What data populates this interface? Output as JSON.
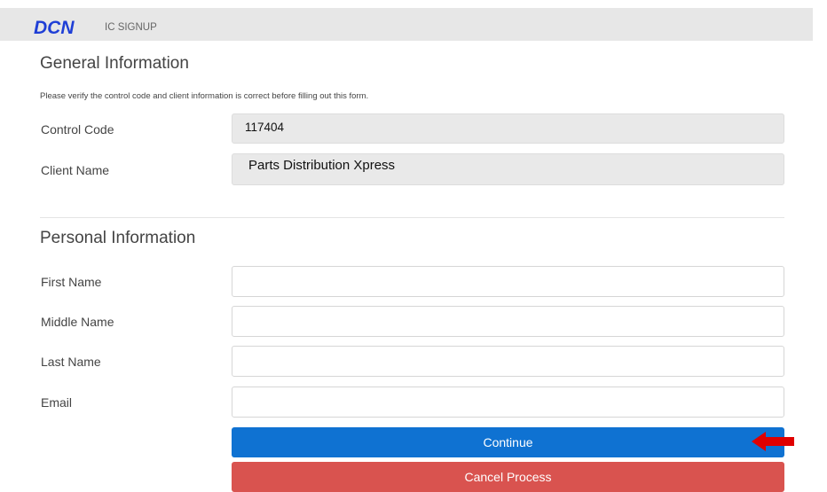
{
  "header": {
    "logo": "DCN",
    "app_title": "IC SIGNUP"
  },
  "general": {
    "title": "General Information",
    "intro": "Please verify the control code and client information is correct before filling out this form.",
    "control_code_label": "Control Code",
    "control_code_value": "117404",
    "client_name_label": "Client Name",
    "client_name_value": "Parts Distribution Xpress"
  },
  "personal": {
    "title": "Personal Information",
    "first_name_label": "First Name",
    "first_name_value": "",
    "middle_name_label": "Middle Name",
    "middle_name_value": "",
    "last_name_label": "Last Name",
    "last_name_value": "",
    "email_label": "Email",
    "email_value": ""
  },
  "actions": {
    "continue_label": "Continue",
    "cancel_label": "Cancel Process"
  },
  "colors": {
    "logo": "#1f3fd6",
    "continue": "#0f72d2",
    "cancel": "#d9534f",
    "annotation_arrow": "#e00000"
  },
  "icons": {
    "annotation": "arrow-left-icon"
  }
}
